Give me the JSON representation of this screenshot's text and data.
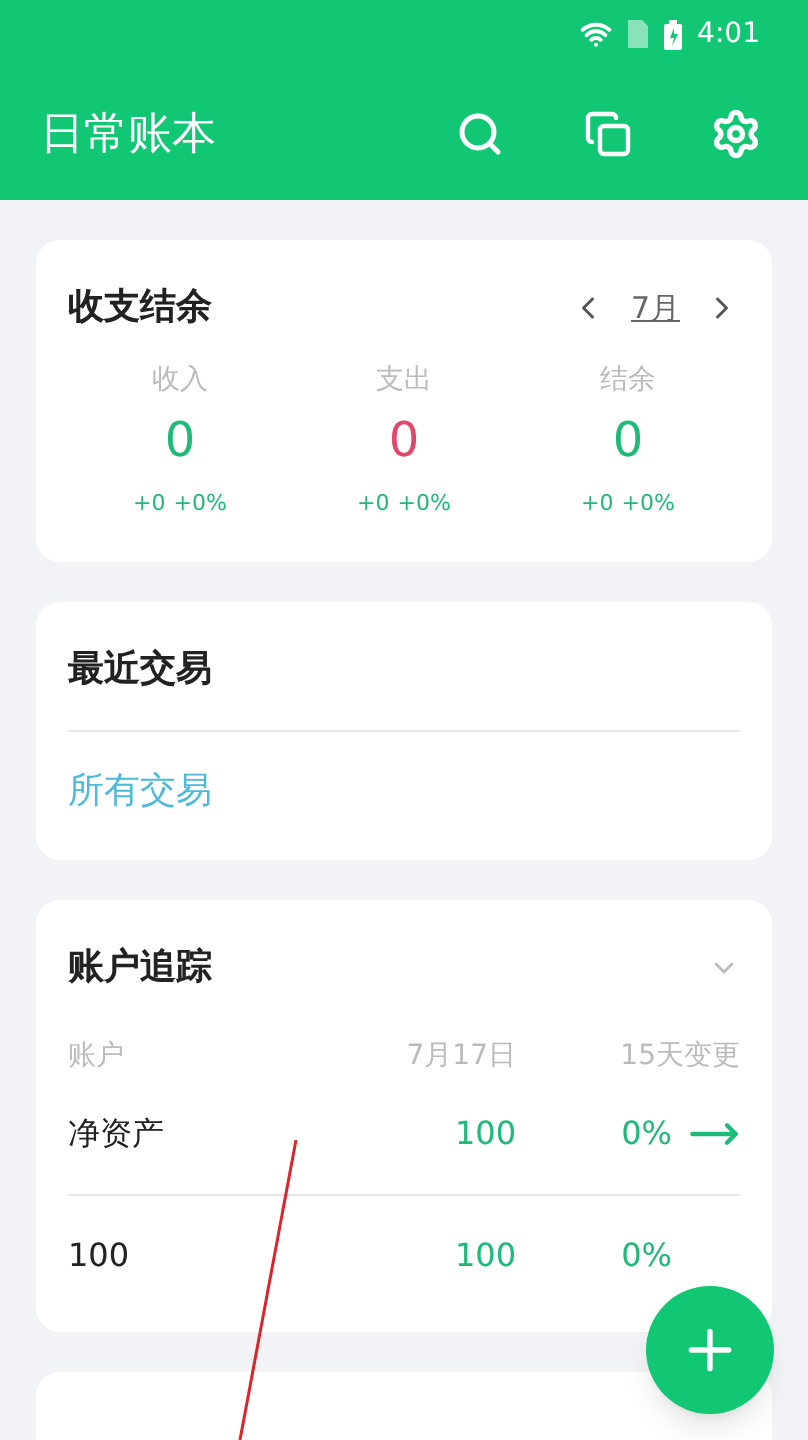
{
  "status_bar": {
    "time": "4:01"
  },
  "app_bar": {
    "title": "日常账本"
  },
  "summary": {
    "title": "收支结余",
    "period": "7月",
    "columns": [
      {
        "label": "收入",
        "value": "0",
        "change": "+0",
        "percent": "+0%",
        "kind": "income"
      },
      {
        "label": "支出",
        "value": "0",
        "change": "+0",
        "percent": "+0%",
        "kind": "expense"
      },
      {
        "label": "结余",
        "value": "0",
        "change": "+0",
        "percent": "+0%",
        "kind": "balance"
      }
    ]
  },
  "recent": {
    "title": "最近交易",
    "link": "所有交易"
  },
  "accounts": {
    "title": "账户追踪",
    "expanded": false,
    "columns": [
      "账户",
      "7月17日",
      "15天变更"
    ],
    "rows": [
      {
        "name": "净资产",
        "value": "100",
        "change": "0%",
        "trend_arrow": true
      },
      {
        "name": "100",
        "value": "100",
        "change": "0%",
        "trend_arrow": false
      }
    ]
  }
}
